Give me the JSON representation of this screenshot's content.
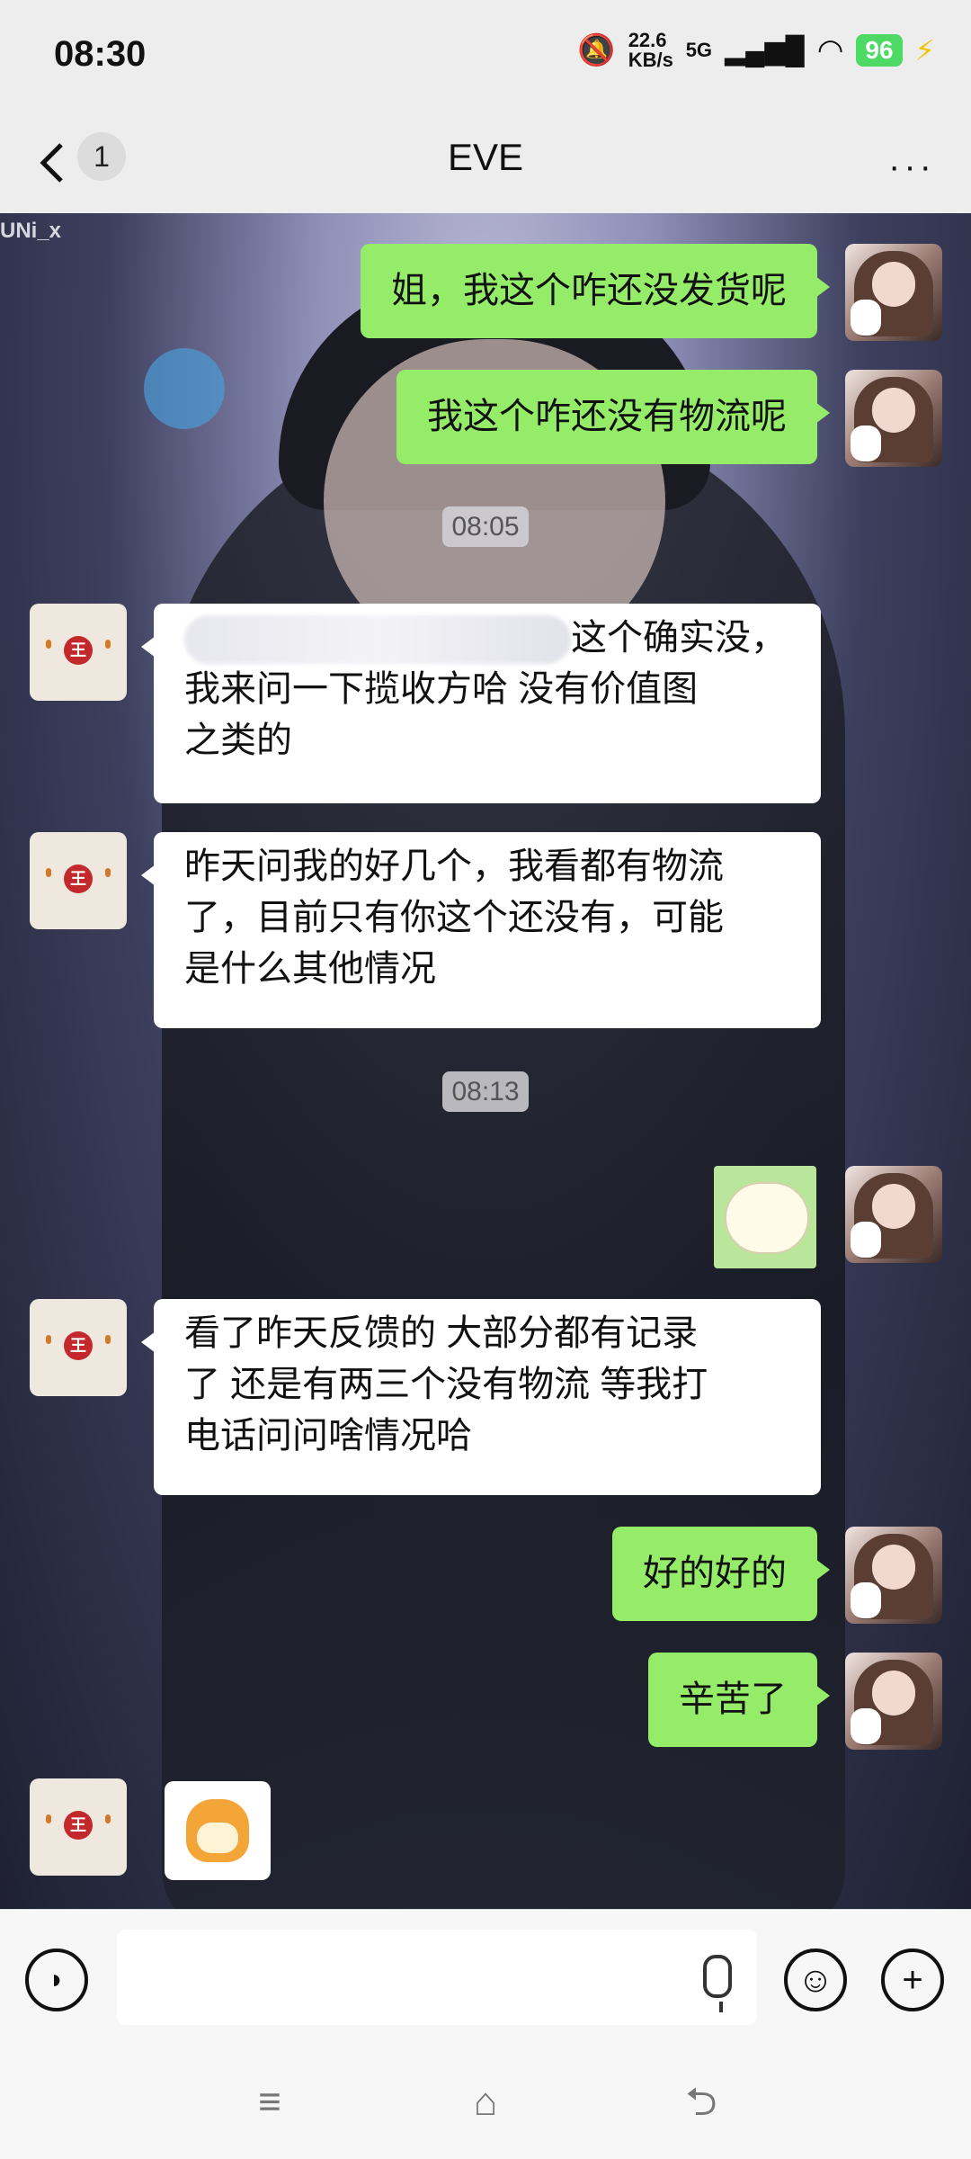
{
  "status": {
    "time": "08:30",
    "net_speed": "22.6 KB/s",
    "network": "5G",
    "battery": "96"
  },
  "header": {
    "unread_count": "1",
    "title": "EVE",
    "more": "···"
  },
  "watermark": "UNi_x",
  "messages": [
    {
      "from": "me",
      "text": "姐，我这个咋还没发货呢"
    },
    {
      "from": "me",
      "text": "我这个咋还没有物流呢"
    },
    {
      "time": "08:05"
    },
    {
      "from": "other",
      "text_visible": "这个确实没，我来问一下揽收方哈 没有价值图之类的",
      "line1": "这个确实没，",
      "line2": "我来问一下揽收方哈 没有价值图",
      "line3": "之类的"
    },
    {
      "from": "other",
      "line1": "昨天问我的好几个，我看都有物流",
      "line2": "了，目前只有你这个还没有，可能",
      "line3": "是什么其他情况"
    },
    {
      "time": "08:13"
    },
    {
      "from": "me",
      "sticker": "hamster-sticker"
    },
    {
      "from": "other",
      "line1": "看了昨天反馈的  大部分都有记录",
      "line2": "了  还是有两三个没有物流 等我打",
      "line3": "电话问问啥情况哈"
    },
    {
      "from": "me",
      "text": "好的好的"
    },
    {
      "from": "me",
      "text": "辛苦了"
    },
    {
      "from": "other",
      "sticker": "doge-sticker"
    }
  ],
  "avatar_other_seal": "王",
  "input": {
    "placeholder": ""
  },
  "icons": {
    "voice": "voice-icon",
    "emoji": "emoji-icon",
    "plus": "plus-icon",
    "mic": "mic-icon",
    "menu": "menu-icon",
    "home": "home-icon",
    "back_nav": "back-nav-icon"
  }
}
